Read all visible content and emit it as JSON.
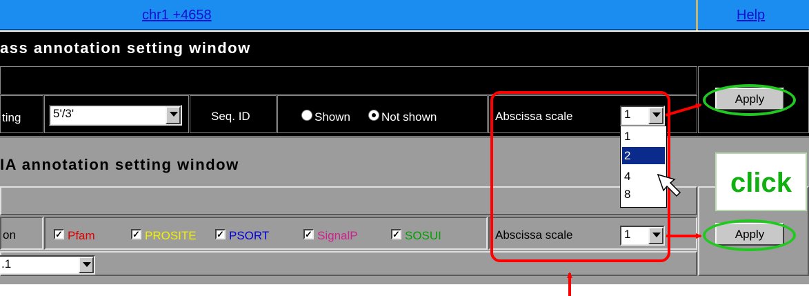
{
  "header": {
    "position_link": "chr1 +4658",
    "help_link": "Help"
  },
  "upper_panel": {
    "title": "ass annotation setting window",
    "setting_label": "ting",
    "setting_value": "5'/3'",
    "seqid_label": "Seq. ID",
    "radio_shown": "Shown",
    "radio_not_shown": "Not shown",
    "radio_selected": "Not shown",
    "abscissa_label": "Abscissa scale",
    "abscissa_value": "1",
    "apply_label": "Apply"
  },
  "dropdown": {
    "options": [
      "1",
      "2",
      "4",
      "8"
    ],
    "highlighted": "2"
  },
  "lower_panel": {
    "title": "IA annotation setting window",
    "row_label": "on",
    "checkboxes": [
      {
        "label": "Pfam",
        "color": "#e00000",
        "checked": true
      },
      {
        "label": "PROSITE",
        "color": "#f0f000",
        "checked": true
      },
      {
        "label": "PSORT",
        "color": "#0000e0",
        "checked": true
      },
      {
        "label": "SignalP",
        "color": "#d02090",
        "checked": true
      },
      {
        "label": "SOSUI",
        "color": "#00a000",
        "checked": true
      }
    ],
    "version_value": ".1",
    "abscissa_label": "Abscissa scale",
    "abscissa_value": "1",
    "apply_label": "Apply"
  },
  "annotation": {
    "click_text": "click",
    "red": "#ff0000",
    "green": "#20c820"
  }
}
